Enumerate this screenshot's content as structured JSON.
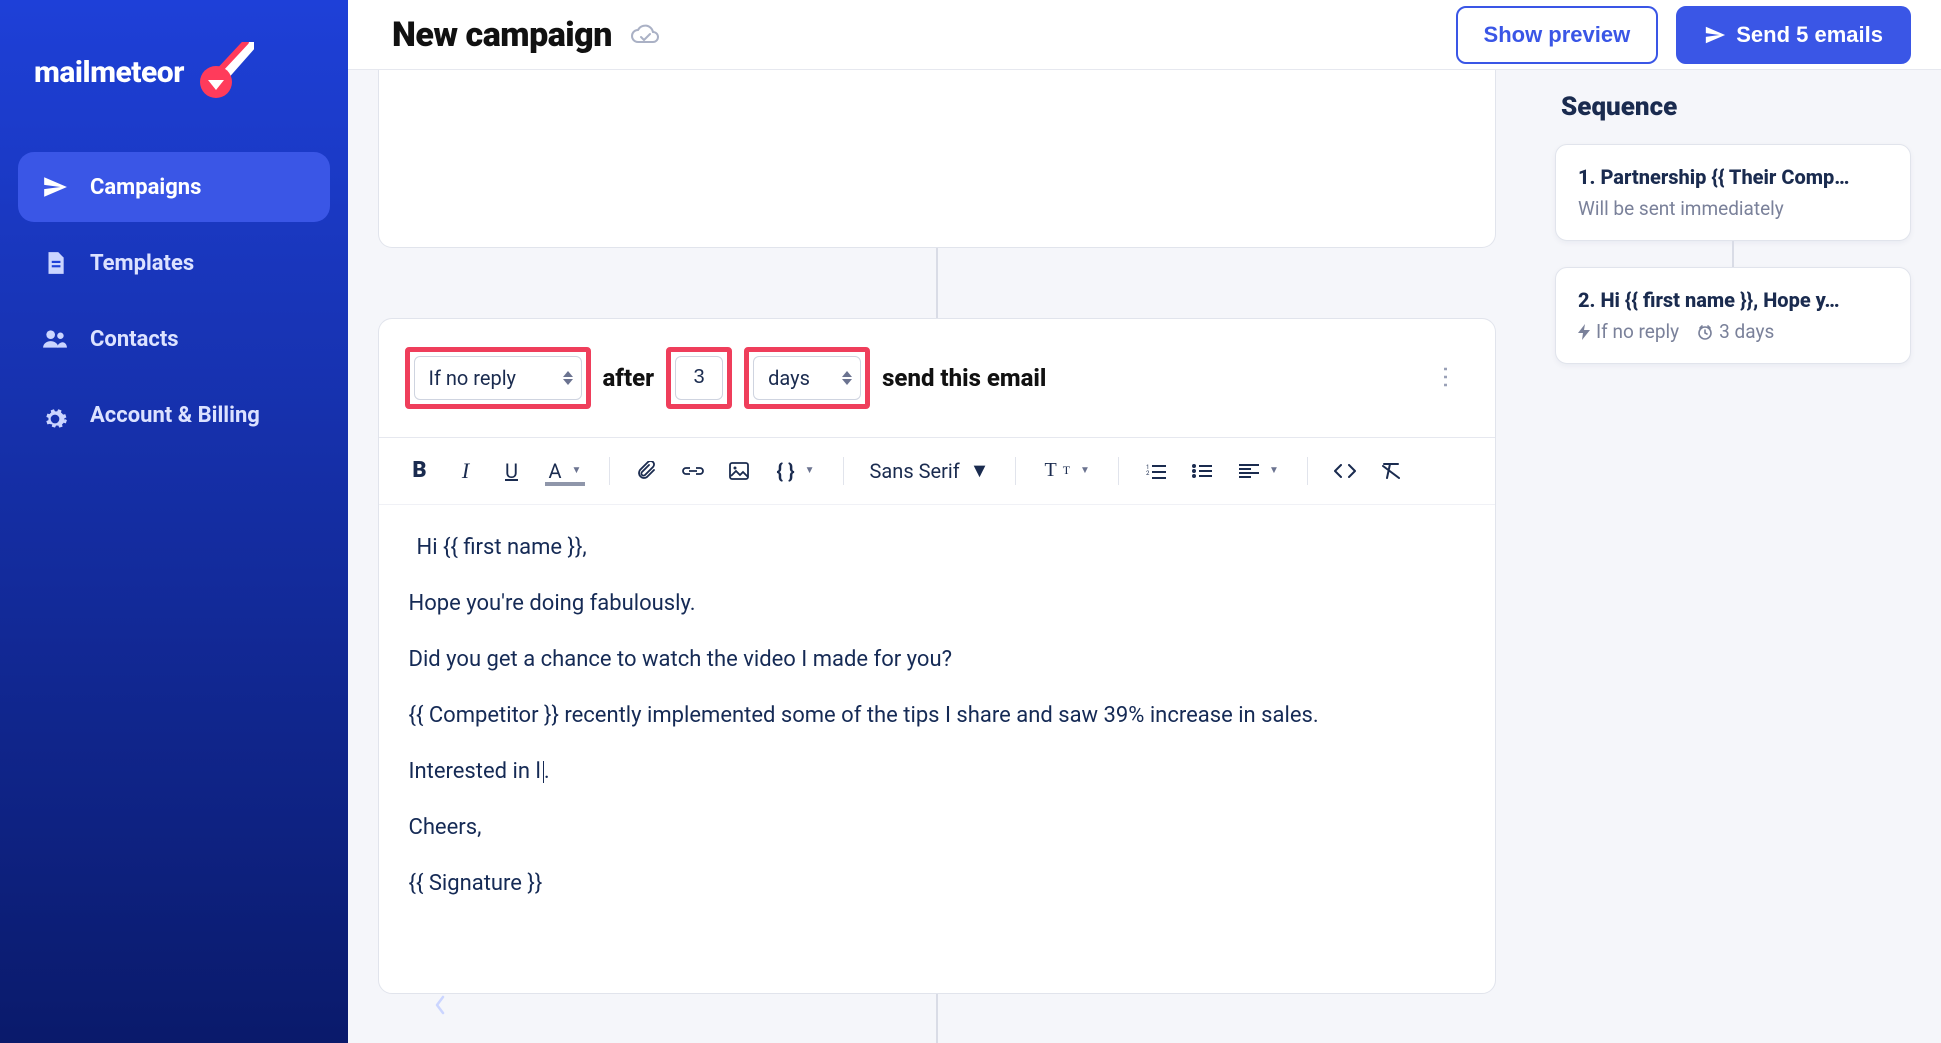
{
  "brand": {
    "name": "mailmeteor"
  },
  "sidebar": {
    "items": [
      {
        "label": "Campaigns",
        "icon": "send"
      },
      {
        "label": "Templates",
        "icon": "document"
      },
      {
        "label": "Contacts",
        "icon": "people"
      },
      {
        "label": "Account & Billing",
        "icon": "gear"
      }
    ]
  },
  "header": {
    "title": "New campaign",
    "preview_label": "Show preview",
    "send_label": "Send 5 emails"
  },
  "followup": {
    "condition": "If no reply",
    "after_label": "after",
    "delay_value": "3",
    "delay_unit": "days",
    "tail_label": "send this email"
  },
  "toolbar": {
    "font": "Sans Serif"
  },
  "email": {
    "lines": [
      "Hi {{ first name }},",
      "Hope you're doing fabulously.",
      "Did you get a chance to watch the video I made for you?",
      "{{ Competitor }} recently implemented some of the tips I share and saw 39% increase in sales.",
      "Interested in l",
      "Cheers,",
      "{{ Signature }}"
    ]
  },
  "sequence": {
    "title": "Sequence",
    "steps": [
      {
        "title": "1. Partnership {{ Their Comp…",
        "sub": "Will be sent immediately"
      },
      {
        "title": "2. Hi {{ first name }}, Hope y…",
        "cond": "If no reply",
        "delay": "3 days"
      }
    ]
  }
}
